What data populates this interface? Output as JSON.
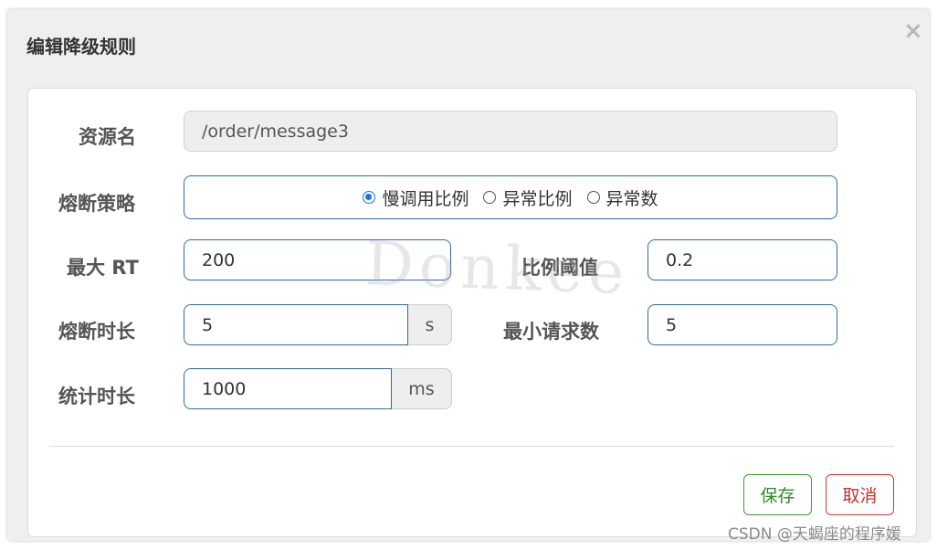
{
  "dialog": {
    "title": "编辑降级规则",
    "close_glyph": "×"
  },
  "form": {
    "resource_label": "资源名",
    "resource_value": "/order/message3",
    "strategy_label": "熔断策略",
    "strategy_options": [
      {
        "label": "慢调用比例",
        "selected": true
      },
      {
        "label": "异常比例",
        "selected": false
      },
      {
        "label": "异常数",
        "selected": false
      }
    ],
    "max_rt_label": "最大 RT",
    "max_rt_value": "200",
    "ratio_label": "比例阈值",
    "ratio_value": "0.2",
    "break_duration_label": "熔断时长",
    "break_duration_value": "5",
    "break_duration_unit": "s",
    "min_request_label": "最小请求数",
    "min_request_value": "5",
    "stat_duration_label": "统计时长",
    "stat_duration_value": "1000",
    "stat_duration_unit": "ms"
  },
  "footer": {
    "save_label": "保存",
    "cancel_label": "取消"
  },
  "overlay": {
    "watermark_text": "Donkee",
    "credit_text": "CSDN @天蝎座的程序媛"
  },
  "colors": {
    "accent": "#1a73e8",
    "field_border": "#2f6aa8",
    "save": "#2e8b2e",
    "cancel": "#c9302c"
  }
}
